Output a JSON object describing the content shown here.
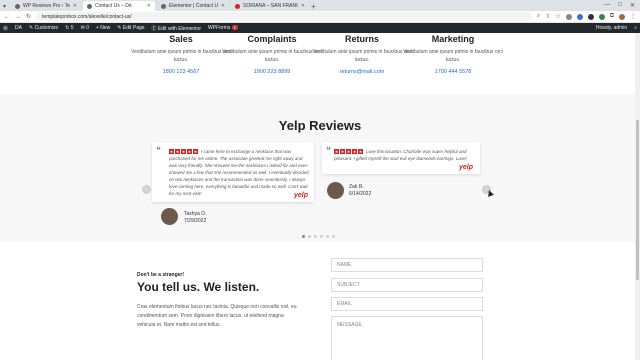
{
  "browser": {
    "tabs": [
      {
        "label": "WP Reviews Pro › Templates ‹ D…",
        "active": false
      },
      {
        "label": "Contact Us – Dé",
        "active": true
      },
      {
        "label": "Elementor | Contact Us",
        "active": false
      },
      {
        "label": "SORIANA – SAN FRANCISCO",
        "active": false
      }
    ],
    "new_tab": "+",
    "url": "templateprobox.com/alexelle/contact-us/"
  },
  "admin_bar": {
    "site": "DA",
    "customize": "Customize",
    "updates": "5",
    "comments": "0",
    "new": "New",
    "edit_page": "Edit Page",
    "edit_elementor": "Edit with Elementor",
    "wpforms": "WPForms",
    "wpforms_badge": "1",
    "howdy": "Howdy, admin"
  },
  "contact_cards": [
    {
      "title": "Sales",
      "text": "Vestibulum ante ipsum primis in faucibus orci luctus.",
      "contact": "1800 123 4567"
    },
    {
      "title": "Complaints",
      "text": "Vestibulum ante ipsum primis in faucibus orci luctus.",
      "contact": "1900 223 8899"
    },
    {
      "title": "Returns",
      "text": "Vestibulum ante ipsum primis in faucibus orci luctus.",
      "contact": "returns@mail.com"
    },
    {
      "title": "Marketing",
      "text": "Vestibulum ante ipsum primis in faucibus orci luctus.",
      "contact": "1700 444 5578"
    }
  ],
  "yelp": {
    "title": "Yelp Reviews",
    "reviews": [
      {
        "text": "I came here to exchange a necklace that was purchased for me online. The associate greeted me right away and was very friendly. She showed me the necklaces I asked for and even showed me a few that she recommended as well. I eventually decided on two necklaces and the transaction was done seamlessly. I always love coming here, everything is beautiful and made so well. Can't wait for my next visit!",
        "author": "Tashya D.",
        "date": "7/29/2022",
        "logo": "yelp"
      },
      {
        "text": "Love this location. Charlotte was super helpful and pleasant. I gifted myself the stud evil eye diamonds earrings. Love!",
        "author": "Zak R.",
        "date": "6/14/2022",
        "logo": "yelp"
      }
    ],
    "star_glyph": "★",
    "prev": "‹",
    "next": "›"
  },
  "form_section": {
    "kicker": "Don't be a stranger!",
    "headline": "You tell us. We listen.",
    "body": "Cras elementum finibus lacus nec lacinia. Quisque non convallis nisl, eu condimentum sem. Proin dignissim libero lacus, ut eleifend magna vehicula et. Nam mattis est sed tellus.",
    "fields": {
      "name": "NAME",
      "subject": "SUBJECT",
      "email": "EMAIL",
      "message": "MESSAGE"
    }
  }
}
